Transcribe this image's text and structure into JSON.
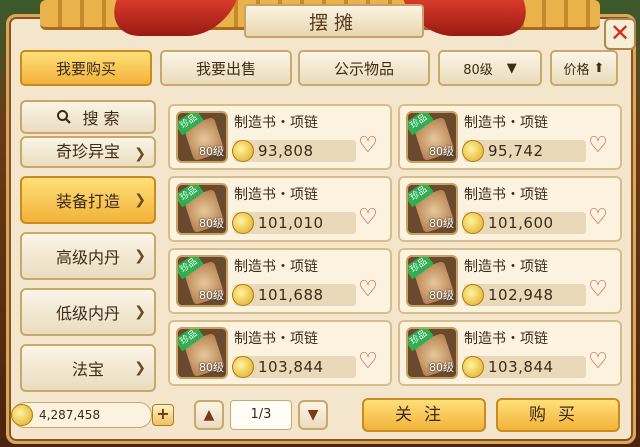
{
  "window": {
    "title": "摆摊"
  },
  "tabs": [
    {
      "label": "我要购买",
      "active": true
    },
    {
      "label": "我要出售",
      "active": false
    },
    {
      "label": "公示物品",
      "active": false
    }
  ],
  "filters": {
    "level": "80级",
    "sort": "价格"
  },
  "sidebar": {
    "search_label": "搜 索",
    "categories": [
      {
        "label": "奇珍异宝",
        "active": false
      },
      {
        "label": "装备打造",
        "active": true
      },
      {
        "label": "高级内丹",
        "active": false
      },
      {
        "label": "低级内丹",
        "active": false
      },
      {
        "label": "法宝",
        "active": false
      }
    ]
  },
  "items": [
    {
      "name": "制造书・项链",
      "level": "80级",
      "tag": "珍品",
      "price": "93,808"
    },
    {
      "name": "制造书・项链",
      "level": "80级",
      "tag": "珍品",
      "price": "95,742"
    },
    {
      "name": "制造书・项链",
      "level": "80级",
      "tag": "珍品",
      "price": "101,010"
    },
    {
      "name": "制造书・项链",
      "level": "80级",
      "tag": "珍品",
      "price": "101,600"
    },
    {
      "name": "制造书・项链",
      "level": "80级",
      "tag": "珍品",
      "price": "101,688"
    },
    {
      "name": "制造书・项链",
      "level": "80级",
      "tag": "珍品",
      "price": "102,948"
    },
    {
      "name": "制造书・项链",
      "level": "80级",
      "tag": "珍品",
      "price": "103,844"
    },
    {
      "name": "制造书・项链",
      "level": "80级",
      "tag": "珍品",
      "price": "103,844"
    }
  ],
  "footer": {
    "money": "4,287,458",
    "page": "1/3",
    "follow_label": "关注",
    "buy_label": "购买"
  }
}
